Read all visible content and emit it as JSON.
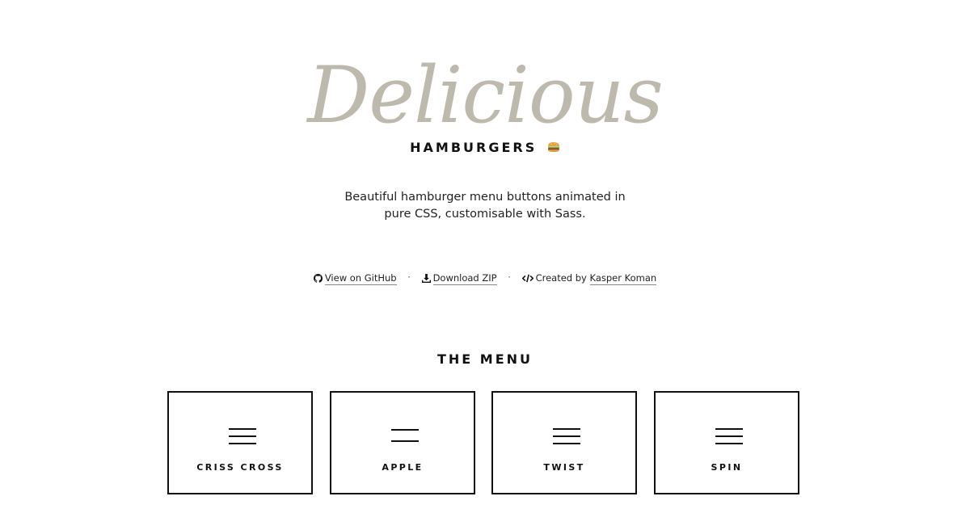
{
  "header": {
    "logo_text": "Delicious",
    "subtitle": "HAMBURGERS",
    "emoji_icon": "hamburger-emoji",
    "tagline": "Beautiful hamburger menu buttons animated in pure CSS, customisable with Sass."
  },
  "links": {
    "github_label": "View on GitHub",
    "download_label": "Download ZIP",
    "created_prefix": "Created by",
    "author_label": "Kasper Koman",
    "separator": "·"
  },
  "menu": {
    "title": "THE MENU",
    "items": [
      {
        "label": "CRISS CROSS",
        "lines": 3
      },
      {
        "label": "APPLE",
        "lines": 2
      },
      {
        "label": "TWIST",
        "lines": 3
      },
      {
        "label": "SPIN",
        "lines": 3
      }
    ]
  },
  "colors": {
    "logo": "#bdb9ad",
    "text": "#111111",
    "background": "#ffffff"
  }
}
